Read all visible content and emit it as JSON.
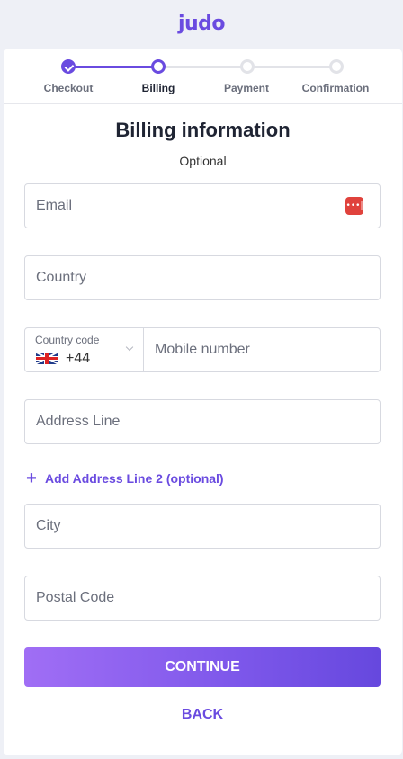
{
  "header": {
    "logo_text": "judo"
  },
  "stepper": {
    "steps": [
      {
        "label": "Checkout",
        "state": "done"
      },
      {
        "label": "Billing",
        "state": "current"
      },
      {
        "label": "Payment",
        "state": "pending"
      },
      {
        "label": "Confirmation",
        "state": "pending"
      }
    ],
    "active_color": "#6a4be0"
  },
  "form": {
    "title": "Billing information",
    "subtitle": "Optional",
    "email": {
      "placeholder": "Email",
      "icon": "password-manager-icon"
    },
    "country": {
      "placeholder": "Country"
    },
    "country_code": {
      "label": "Country code",
      "value": "+44",
      "flag": "uk-flag-icon"
    },
    "mobile": {
      "placeholder": "Mobile number"
    },
    "address_line": {
      "placeholder": "Address Line"
    },
    "add_address_line2": {
      "label": "Add Address Line 2 (optional)",
      "icon": "plus-icon"
    },
    "city": {
      "placeholder": "City"
    },
    "postal_code": {
      "placeholder": "Postal Code"
    }
  },
  "actions": {
    "continue_label": "CONTINUE",
    "back_label": "BACK"
  }
}
